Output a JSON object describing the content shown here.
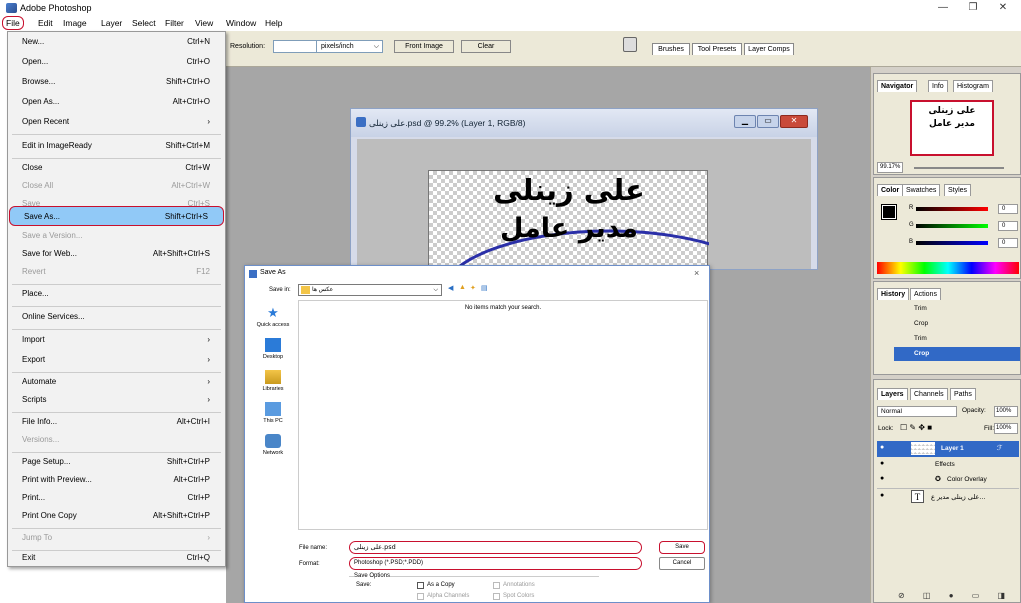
{
  "window": {
    "title": "Adobe Photoshop",
    "min": "—",
    "restore": "❐",
    "close": "✕"
  },
  "menubar": [
    "File",
    "Edit",
    "Image",
    "Layer",
    "Select",
    "Filter",
    "View",
    "Window",
    "Help"
  ],
  "options_bar": {
    "resolution_label": "Resolution:",
    "resolution_value": "",
    "unit": "pixels/inch",
    "front_image": "Front Image",
    "clear": "Clear",
    "tabs": [
      "Brushes",
      "Tool Presets",
      "Layer Comps"
    ]
  },
  "file_menu": [
    {
      "label": "New...",
      "shortcut": "Ctrl+N"
    },
    {
      "label": "Open...",
      "shortcut": "Ctrl+O"
    },
    {
      "label": "Browse...",
      "shortcut": "Shift+Ctrl+O"
    },
    {
      "label": "Open As...",
      "shortcut": "Alt+Ctrl+O"
    },
    {
      "label": "Open Recent",
      "shortcut": "›"
    },
    {
      "label": "Edit in ImageReady",
      "shortcut": "Shift+Ctrl+M"
    },
    {
      "label": "Close",
      "shortcut": "Ctrl+W"
    },
    {
      "label": "Close All",
      "shortcut": "Alt+Ctrl+W"
    },
    {
      "label": "Save",
      "shortcut": "Ctrl+S"
    },
    {
      "label": "Save As...",
      "shortcut": "Shift+Ctrl+S"
    },
    {
      "label": "Save a Version...",
      "shortcut": ""
    },
    {
      "label": "Save for Web...",
      "shortcut": "Alt+Shift+Ctrl+S"
    },
    {
      "label": "Revert",
      "shortcut": "F12"
    },
    {
      "label": "Place...",
      "shortcut": ""
    },
    {
      "label": "Online Services...",
      "shortcut": ""
    },
    {
      "label": "Import",
      "shortcut": "›"
    },
    {
      "label": "Export",
      "shortcut": "›"
    },
    {
      "label": "Automate",
      "shortcut": "›"
    },
    {
      "label": "Scripts",
      "shortcut": "›"
    },
    {
      "label": "File Info...",
      "shortcut": "Alt+Ctrl+I"
    },
    {
      "label": "Versions...",
      "shortcut": ""
    },
    {
      "label": "Page Setup...",
      "shortcut": "Shift+Ctrl+P"
    },
    {
      "label": "Print with Preview...",
      "shortcut": "Alt+Ctrl+P"
    },
    {
      "label": "Print...",
      "shortcut": "Ctrl+P"
    },
    {
      "label": "Print One Copy",
      "shortcut": "Alt+Shift+Ctrl+P"
    },
    {
      "label": "Jump To",
      "shortcut": "›"
    },
    {
      "label": "Exit",
      "shortcut": "Ctrl+Q"
    }
  ],
  "document": {
    "title": "علی زینلی.psd @ 99.2% (Layer 1, RGB/8)",
    "text_line1": "علی زینلی",
    "text_line2": "مدیر عامل"
  },
  "save_dialog": {
    "title": "Save As",
    "save_in_label": "Save in:",
    "save_in_value": "عکس ها",
    "empty_message": "No items match your search.",
    "sidebar": [
      "Quick access",
      "Desktop",
      "Libraries",
      "This PC",
      "Network"
    ],
    "filename_label": "File name:",
    "filename_value": "علی زینلی.psd",
    "format_label": "Format:",
    "format_value": "Photoshop (*.PSD;*.PDD)",
    "save_button": "Save",
    "cancel_button": "Cancel",
    "options_title": "Save Options",
    "options_save": "Save:",
    "as_copy": "As a Copy",
    "annotations": "Annotations",
    "alpha_channels": "Alpha Channels",
    "spot_colors": "Spot Colors"
  },
  "navigator": {
    "tabs": [
      "Navigator",
      "Info",
      "Histogram"
    ],
    "zoom": "99.17%"
  },
  "color_panel": {
    "tabs": [
      "Color",
      "Swatches",
      "Styles"
    ],
    "r_label": "R",
    "g_label": "G",
    "b_label": "B",
    "r": "0",
    "g": "0",
    "b": "0"
  },
  "history": {
    "tabs": [
      "History",
      "Actions"
    ],
    "items": [
      "Trim",
      "Crop",
      "Trim",
      "Crop"
    ]
  },
  "layers": {
    "tabs": [
      "Layers",
      "Channels",
      "Paths"
    ],
    "blend_mode": "Normal",
    "opacity_label": "Opacity:",
    "opacity": "100%",
    "lock_label": "Lock:",
    "fill_label": "Fill:",
    "fill": "100%",
    "layer1": "Layer 1",
    "effects": "Effects",
    "color_overlay": "Color Overlay",
    "text_layer": "علی زینلی مدیر ع..."
  },
  "colors": {
    "highlight": "#91c9f7",
    "annotation_red": "#c8102e",
    "selection_blue": "#3169c6"
  }
}
